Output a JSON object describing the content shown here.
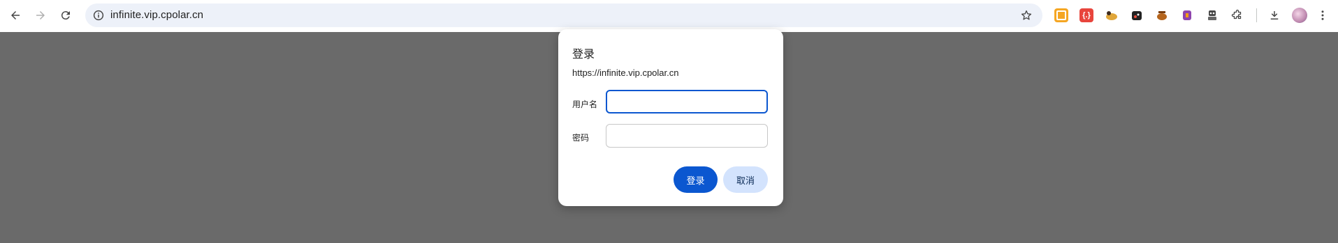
{
  "browser": {
    "url": "infinite.vip.cpolar.cn",
    "icons": {
      "back": "back-arrow-icon",
      "forward": "forward-arrow-icon",
      "reload": "reload-icon",
      "site_info": "info-icon",
      "bookmark": "star-icon",
      "extensions_menu": "puzzle-icon",
      "downloads": "download-icon",
      "profile": "avatar",
      "menu": "kebab-menu-icon"
    },
    "extensions": [
      {
        "name": "ext-yellow",
        "color": "#f5a623",
        "glyph": ""
      },
      {
        "name": "ext-red",
        "color": "#e8453c",
        "glyph": "{.}"
      },
      {
        "name": "ext-cat",
        "color": "#e0a63a",
        "glyph": ""
      },
      {
        "name": "ext-dark",
        "color": "#222222",
        "glyph": ""
      },
      {
        "name": "ext-bowl",
        "color": "#b5651d",
        "glyph": ""
      },
      {
        "name": "ext-purple",
        "color": "#8e44ad",
        "glyph": ""
      },
      {
        "name": "ext-robot",
        "color": "#444444",
        "glyph": ""
      }
    ]
  },
  "dialog": {
    "title": "登录",
    "origin": "https://infinite.vip.cpolar.cn",
    "username_label": "用户名",
    "username_value": "",
    "password_label": "密码",
    "password_value": "",
    "submit_label": "登录",
    "cancel_label": "取消"
  },
  "colors": {
    "accent": "#0b57d0",
    "secondary_button": "#d3e3fd",
    "overlay": "#6a6a6a"
  }
}
